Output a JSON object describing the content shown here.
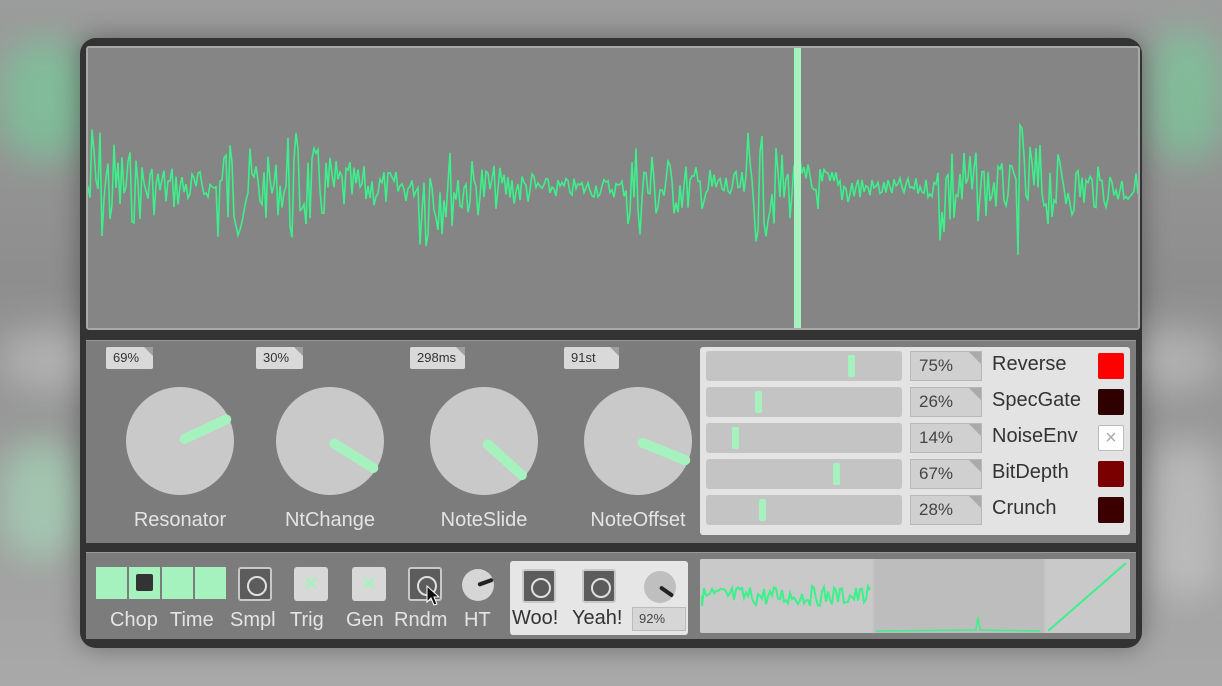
{
  "colors": {
    "accent": "#a6f2bf",
    "wave": "#3cf08a",
    "panel": "#7c7c7c",
    "light_panel": "#e3e3e3"
  },
  "knobs": [
    {
      "label": "Resonator",
      "value": "69%",
      "angle": -25
    },
    {
      "label": "NtChange",
      "value": "30%",
      "angle": 32
    },
    {
      "label": "NoteSlide",
      "value": "298ms",
      "angle": 42
    },
    {
      "label": "NoteOffset",
      "value": "91st",
      "angle": 22
    }
  ],
  "sliders": [
    {
      "label": "Reverse",
      "value": "75%",
      "fraction": 0.75,
      "swatch": "#ff0000",
      "swatch_icon": ""
    },
    {
      "label": "SpecGate",
      "value": "26%",
      "fraction": 0.26,
      "swatch": "#2e0000",
      "swatch_icon": ""
    },
    {
      "label": "NoiseEnv",
      "value": "14%",
      "fraction": 0.14,
      "swatch": "#ffffff",
      "swatch_icon": "×"
    },
    {
      "label": "BitDepth",
      "value": "67%",
      "fraction": 0.67,
      "swatch": "#7a0000",
      "swatch_icon": ""
    },
    {
      "label": "Crunch",
      "value": "28%",
      "fraction": 0.28,
      "swatch": "#3a0000",
      "swatch_icon": ""
    }
  ],
  "bottom": {
    "chop_label": "Chop",
    "time_label": "Time",
    "smpl_label": "Smpl",
    "trig_label": "Trig",
    "gen_label": "Gen",
    "rndm_label": "Rndm",
    "ht_label": "HT",
    "woo_label": "Woo!",
    "yeah_label": "Yeah!",
    "mix_value": "92%",
    "x_icon": "×"
  }
}
